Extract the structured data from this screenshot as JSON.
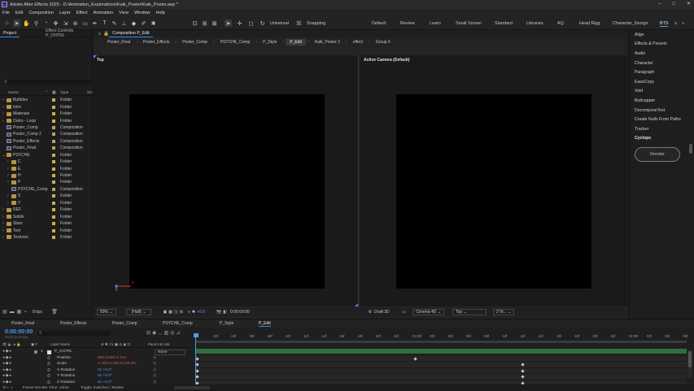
{
  "titlebar": {
    "app_icon": "Ae",
    "title": "Adobe After Effects 2025 - D:\\Animation_Explorations\\Kaik_Poster\\Kaik_Poster.aep *",
    "min": "–",
    "max": "□",
    "close": "✕"
  },
  "menu": [
    "File",
    "Edit",
    "Composition",
    "Layer",
    "Effect",
    "Animation",
    "View",
    "Window",
    "Help"
  ],
  "toolbar": {
    "universal": "Universal",
    "snapping": "Snapping"
  },
  "workspaces": [
    "Default",
    "Review",
    "Learn",
    "Small Screen",
    "Standard",
    "Libraries",
    "AQ",
    "Head Rigg",
    "Character_Design",
    "BTS"
  ],
  "project": {
    "tab_project": "Project",
    "tab_effects": "Effect Controls P_CNTRL",
    "col_name": "Name",
    "col_type": "Type",
    "col_size": "Siz",
    "bpc": "8 bpc",
    "items": [
      {
        "name": "Bubbles",
        "type": "Folder",
        "indent": 0,
        "kind": "folder",
        "arrow": "›",
        "color": "#c9b24a"
      },
      {
        "name": "Intro",
        "type": "Folder",
        "indent": 0,
        "kind": "folder",
        "arrow": "›",
        "color": "#c9b24a"
      },
      {
        "name": "Materials",
        "type": "Folder",
        "indent": 0,
        "kind": "folder",
        "arrow": "›",
        "color": "#c9b24a"
      },
      {
        "name": "Outro - Loop",
        "type": "Folder",
        "indent": 0,
        "kind": "folder",
        "arrow": "›",
        "color": "#c9b24a"
      },
      {
        "name": "Poster_Comp",
        "type": "Composition",
        "indent": 0,
        "kind": "comp",
        "arrow": "",
        "color": "#b0a26a"
      },
      {
        "name": "Poster_Comp 2",
        "type": "Composition",
        "indent": 0,
        "kind": "comp",
        "arrow": "",
        "color": "#b0a26a"
      },
      {
        "name": "Poster_Effects",
        "type": "Composition",
        "indent": 0,
        "kind": "comp",
        "arrow": "",
        "color": "#b0a26a"
      },
      {
        "name": "Poster_Final",
        "type": "Composition",
        "indent": 0,
        "kind": "comp",
        "arrow": "",
        "color": "#b0a26a"
      },
      {
        "name": "PSYCHE",
        "type": "Folder",
        "indent": 0,
        "kind": "folder",
        "arrow": "⌄",
        "color": "#c9b24a"
      },
      {
        "name": "C",
        "type": "Folder",
        "indent": 1,
        "kind": "folder",
        "arrow": "›",
        "color": "#c9b24a"
      },
      {
        "name": "E",
        "type": "Folder",
        "indent": 1,
        "kind": "folder",
        "arrow": "›",
        "color": "#c9b24a"
      },
      {
        "name": "H",
        "type": "Folder",
        "indent": 1,
        "kind": "folder",
        "arrow": "›",
        "color": "#c9b24a"
      },
      {
        "name": "P",
        "type": "Folder",
        "indent": 1,
        "kind": "folder",
        "arrow": "›",
        "color": "#c9b24a"
      },
      {
        "name": "PSYCHE_Comp",
        "type": "Composition",
        "indent": 1,
        "kind": "comp",
        "arrow": "",
        "color": "#b0a26a"
      },
      {
        "name": "S",
        "type": "Folder",
        "indent": 1,
        "kind": "folder",
        "arrow": "›",
        "color": "#c9b24a"
      },
      {
        "name": "Y",
        "type": "Folder",
        "indent": 1,
        "kind": "folder",
        "arrow": "›",
        "color": "#c9b24a"
      },
      {
        "name": "REF",
        "type": "Folder",
        "indent": 0,
        "kind": "folder",
        "arrow": "›",
        "color": "#c9b24a"
      },
      {
        "name": "Solids",
        "type": "Folder",
        "indent": 0,
        "kind": "folder",
        "arrow": "›",
        "color": "#c9b24a"
      },
      {
        "name": "Stars",
        "type": "Folder",
        "indent": 0,
        "kind": "folder",
        "arrow": "›",
        "color": "#c9b24a"
      },
      {
        "name": "Text",
        "type": "Folder",
        "indent": 0,
        "kind": "folder",
        "arrow": "›",
        "color": "#c9b24a"
      },
      {
        "name": "Textures",
        "type": "Folder",
        "indent": 0,
        "kind": "folder",
        "arrow": "›",
        "color": "#c9b24a"
      }
    ]
  },
  "composition": {
    "panel_tab": "Composition P_Edit",
    "comp_tabs": [
      "Poster_Final",
      "Poster_Effects",
      "Poster_Comp",
      "PSYCHE_Comp",
      "P_Style",
      "P_Edit",
      "Kaik_Poster 2",
      "effect",
      "Group 5"
    ],
    "active_tab": "P_Edit",
    "left_view": "Top",
    "right_view": "Active Camera (Default)",
    "zoom": "50%",
    "resolution": "(Half)",
    "exposure": "+0.0",
    "timecode": "0:00:00:00",
    "renderer": "Draft 3D",
    "renderer_mode": "Cinema 4D",
    "view_select": "Top",
    "views": "2 Vi..."
  },
  "right_panel": {
    "items": [
      "Align",
      "Effects & Presets",
      "Audio",
      "Character",
      "Paragraph",
      "EaseCopy",
      "Void",
      "Buttcapper",
      "DecomposeText",
      "Create Nulls From Paths",
      "Tracker",
      "Cyclops"
    ],
    "render_button": "Render"
  },
  "timeline": {
    "tabs": [
      "Poster_Final",
      "Poster_Effects",
      "Poster_Comp",
      "PSYCHE_Comp",
      "P_Style",
      "P_Edit"
    ],
    "active_tab": "P_Edit",
    "timecode": "0:00:00:00",
    "timecode_sub": "00000 (24.00 fps)",
    "col_layer": "Layer Name",
    "col_parent": "Parent & Link",
    "ruler": [
      "0f",
      "02f",
      "04f",
      "06f",
      "08f",
      "10f",
      "12f",
      "14f",
      "16f",
      "18f",
      "20f",
      "22f",
      "01:00f",
      "02f",
      "04f",
      "06f",
      "08f",
      "10f",
      "12f",
      "14f",
      "16f",
      "18f",
      "20f",
      "22f",
      "02:00f",
      "02f",
      "04f",
      "06f"
    ],
    "layers": [
      {
        "num": "1",
        "name": "P_CNTRL",
        "value": "",
        "parent": "None",
        "is_layer": true
      },
      {
        "num": "",
        "name": "Position",
        "value": "960.0,540.0,-0.0",
        "parent": "",
        "is_layer": false
      },
      {
        "num": "",
        "name": "Scale",
        "value": "∞ 100.0,100.0,100.0%",
        "parent": "",
        "is_layer": false
      },
      {
        "num": "",
        "name": "X Rotation",
        "value": "0x +0.0°",
        "parent": "",
        "is_layer": false
      },
      {
        "num": "",
        "name": "Y Rotation",
        "value": "0x +0.0°",
        "parent": "",
        "is_layer": false
      },
      {
        "num": "",
        "name": "Z Rotation",
        "value": "0x +0.0°",
        "parent": "",
        "is_layer": false
      }
    ],
    "frame_render": "Frame Render Time: 44ms",
    "toggle_label": "Toggle Switches / Modes"
  }
}
